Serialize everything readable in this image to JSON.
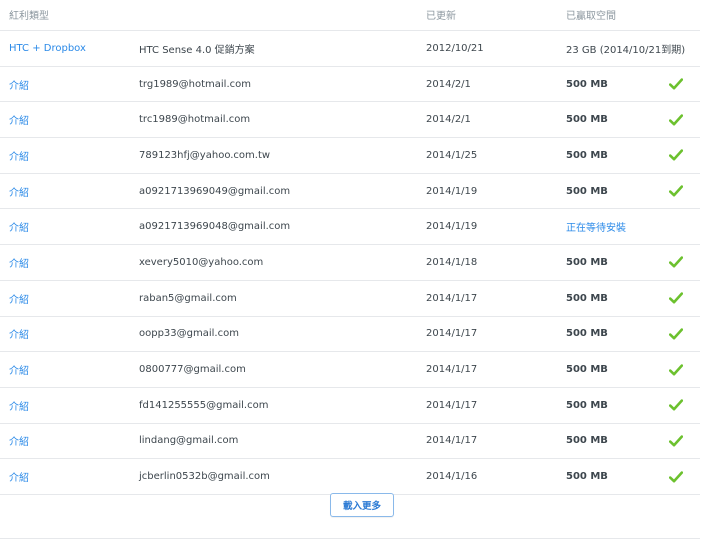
{
  "columns": {
    "type": "紅利類型",
    "account": "",
    "updated": "已更新",
    "earned": "已贏取空間"
  },
  "promo_row": {
    "type": "HTC + Dropbox",
    "account": "HTC Sense 4.0 促銷方案",
    "updated": "2012/10/21",
    "earned": "23 GB (2014/10/21到期)"
  },
  "referrals": [
    {
      "type": "介紹",
      "account": "trg1989@hotmail.com",
      "updated": "2014/2/1",
      "earned": "500 MB",
      "status": "done"
    },
    {
      "type": "介紹",
      "account": "trc1989@hotmail.com",
      "updated": "2014/2/1",
      "earned": "500 MB",
      "status": "done"
    },
    {
      "type": "介紹",
      "account": "789123hfj@yahoo.com.tw",
      "updated": "2014/1/25",
      "earned": "500 MB",
      "status": "done"
    },
    {
      "type": "介紹",
      "account": "a0921713969049@gmail.com",
      "updated": "2014/1/19",
      "earned": "500 MB",
      "status": "done"
    },
    {
      "type": "介紹",
      "account": "a0921713969048@gmail.com",
      "updated": "2014/1/19",
      "earned": "正在等待安裝",
      "status": "pending"
    },
    {
      "type": "介紹",
      "account": "xevery5010@yahoo.com",
      "updated": "2014/1/18",
      "earned": "500 MB",
      "status": "done"
    },
    {
      "type": "介紹",
      "account": "raban5@gmail.com",
      "updated": "2014/1/17",
      "earned": "500 MB",
      "status": "done"
    },
    {
      "type": "介紹",
      "account": "oopp33@gmail.com",
      "updated": "2014/1/17",
      "earned": "500 MB",
      "status": "done"
    },
    {
      "type": "介紹",
      "account": "0800777@gmail.com",
      "updated": "2014/1/17",
      "earned": "500 MB",
      "status": "done"
    },
    {
      "type": "介紹",
      "account": "fd141255555@gmail.com",
      "updated": "2014/1/17",
      "earned": "500 MB",
      "status": "done"
    },
    {
      "type": "介紹",
      "account": "lindang@gmail.com",
      "updated": "2014/1/17",
      "earned": "500 MB",
      "status": "done"
    },
    {
      "type": "介紹",
      "account": "jcberlin0532b@gmail.com",
      "updated": "2014/1/16",
      "earned": "500 MB",
      "status": "done"
    }
  ],
  "icons": {
    "done": "check-icon"
  },
  "colors": {
    "link": "#2b8ae8",
    "check": "#6cc12e",
    "text": "#3d464d",
    "header": "#8c979f"
  },
  "load_more_label": "載入更多"
}
